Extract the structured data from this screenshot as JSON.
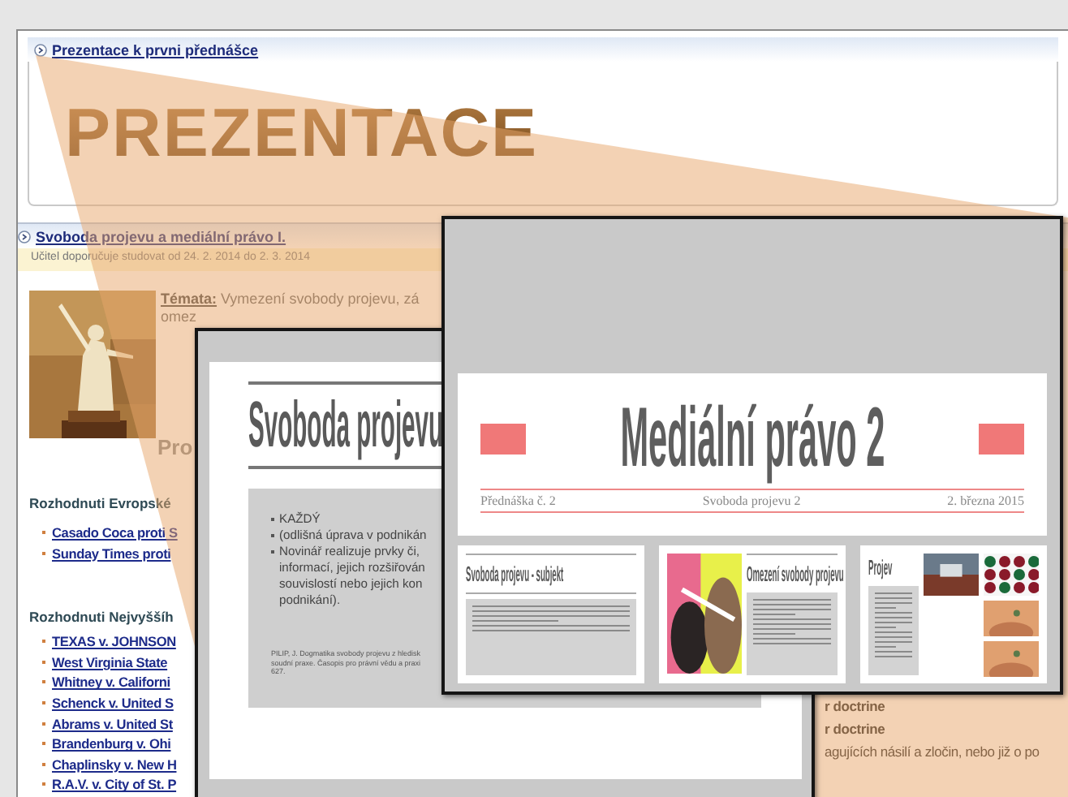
{
  "presentation_section": {
    "title": "Prezentace k prvni přednášce",
    "banner": "PREZENTACE"
  },
  "lecture_section": {
    "title": "Svoboda projevu a mediální právo I.",
    "recommendation": "Učitel doporučuje studovat od 24. 2. 2014 do 2. 3. 2014",
    "topics": [
      "**Témata:** Vymezení svobody projevu, zá",
      "omez"
    ],
    "heading": "Pro",
    "groups": [
      {
        "title": "Rozhodnuti Evropské",
        "links": [
          "Casado Coca proti S",
          "Sunday Times proti"
        ]
      },
      {
        "title": "Rozhodnuti Nejvyššíh",
        "links": [
          "TEXAS v. JOHNSON",
          "West Virginia State",
          "Whitney v. Californi",
          "Schenck v. United S",
          "Abrams v. United St",
          "Brandenburg v. Ohi",
          "Chaplinsky v. New H",
          "R.A.V. v. City of St. P"
        ]
      }
    ],
    "side_lines": [
      {
        "text": "r doctrine",
        "bold": true
      },
      {
        "text": "r doctrine",
        "bold": true
      },
      {
        "text": "agujících násilí a zločin, nebo již o po",
        "bold": false
      }
    ]
  },
  "slides": [
    {
      "kind": "text_slide",
      "title": "Svoboda projevu",
      "bullets": [
        {
          "text": "KAŽDÝ",
          "bullet": true
        },
        {
          "text": "(odlišná úprava v podnikán",
          "bullet": true
        },
        {
          "text": "Novinář realizuje prvky či,",
          "bullet": true
        },
        {
          "text": "informací, jejich rozšiřován",
          "bullet": false
        },
        {
          "text": "souvislostí nebo jejich kon",
          "bullet": false
        },
        {
          "text": "podnikání).",
          "bullet": false
        }
      ],
      "footnote": [
        "PILIP, J. Dogmatika svobody projevu z hledisk",
        "soudní praxe. Časopis pro právní vědu a praxi",
        "627."
      ]
    },
    {
      "kind": "title_slide",
      "title": "Mediální právo 2",
      "subtitle": [
        "Přednáška č. 2",
        "Svoboda projevu 2",
        "2. března 2015"
      ],
      "thumbnails": [
        {
          "kind": "text",
          "title": "Svoboda projevu - subjekt"
        },
        {
          "kind": "photo_text",
          "title": "Omezení svobody projevu"
        },
        {
          "kind": "gallery",
          "title": "Projev"
        }
      ]
    }
  ]
}
